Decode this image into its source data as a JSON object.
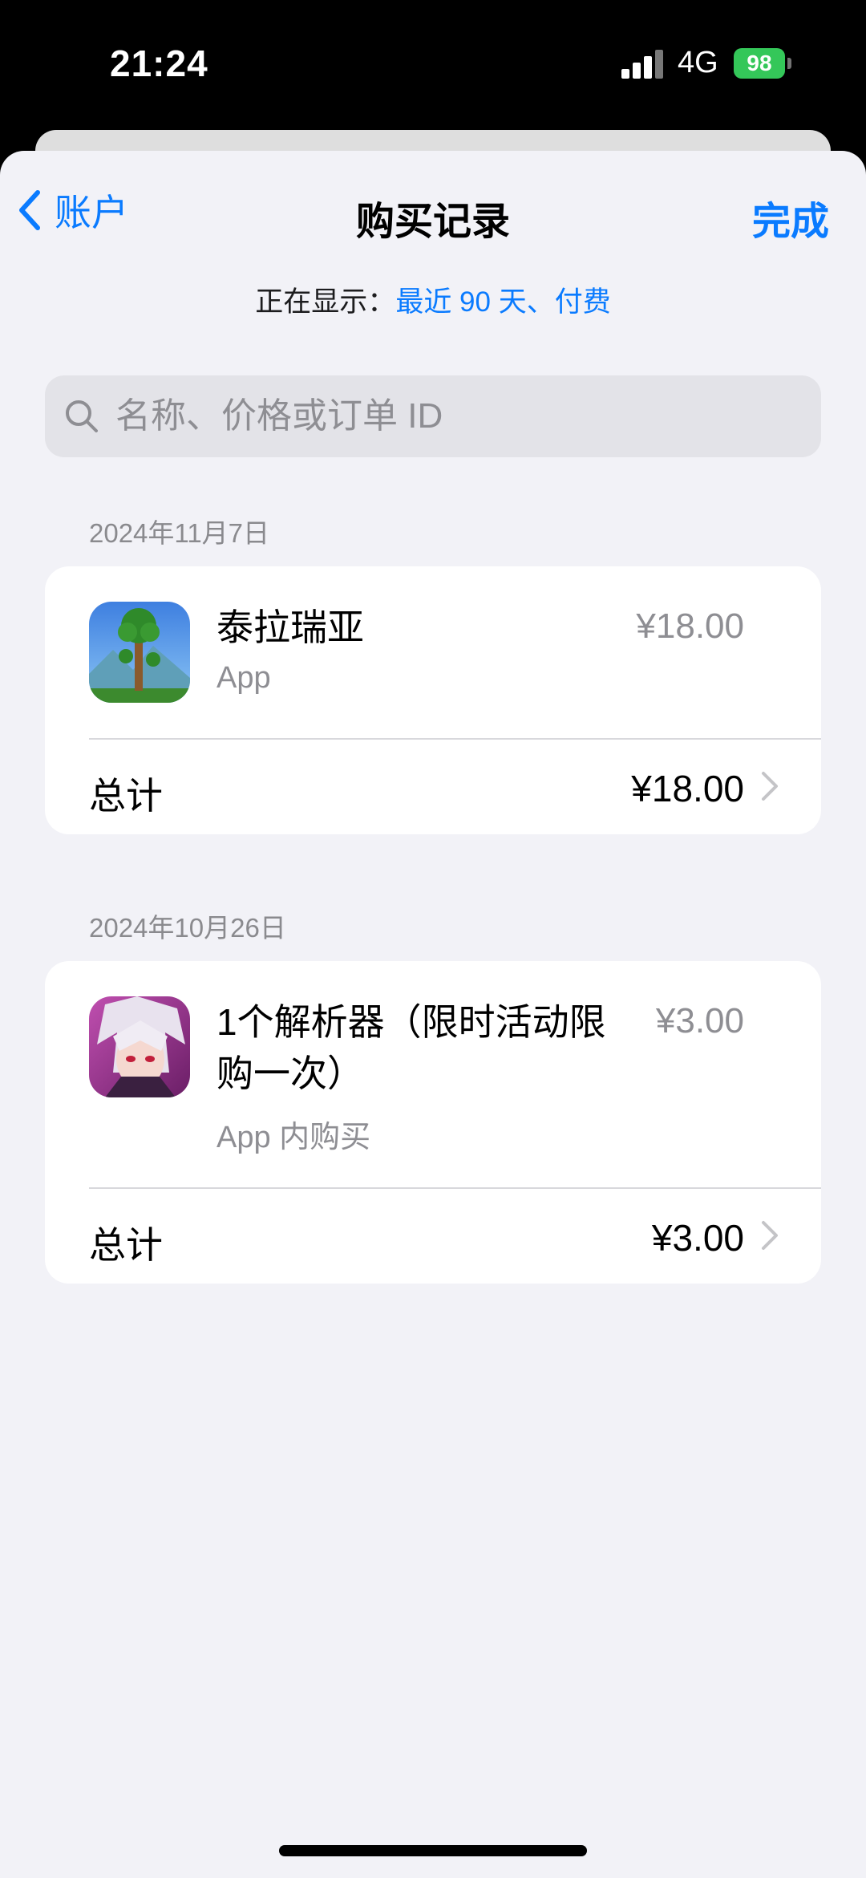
{
  "status": {
    "time": "21:24",
    "network": "4G",
    "battery": "98"
  },
  "nav": {
    "back_label": "账户",
    "title": "购买记录",
    "done_label": "完成"
  },
  "filter": {
    "label": "正在显示：",
    "value": "最近 90 天、付费"
  },
  "search": {
    "placeholder": "名称、价格或订单 ID",
    "value": ""
  },
  "purchases": [
    {
      "date": "2024年11月7日",
      "item_name": "泰拉瑞亚",
      "item_type": "App",
      "price": "¥18.00",
      "total_label": "总计",
      "total": "¥18.00",
      "icon": "terraria-app-icon"
    },
    {
      "date": "2024年10月26日",
      "item_name_line1": "1个解析器（限时活动限",
      "item_name_line2": "购一次）",
      "item_type": "App 内购买",
      "price": "¥3.00",
      "total_label": "总计",
      "total": "¥3.00",
      "icon": "anime-app-icon"
    }
  ],
  "colors": {
    "accent": "#0a7bff",
    "background": "#f2f2f7",
    "battery": "#34c759"
  }
}
